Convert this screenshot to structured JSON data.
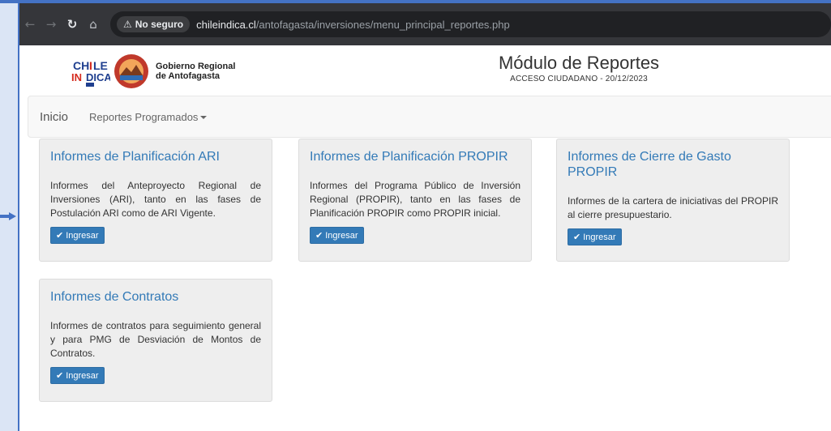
{
  "browser": {
    "back_icon": "back-arrow-icon",
    "forward_icon": "forward-arrow-icon",
    "reload_icon": "reload-icon",
    "home_icon": "home-icon",
    "security_label": "No seguro",
    "url_domain": "chileindica.cl",
    "url_path": "/antofagasta/inversiones/menu_principal_reportes.php"
  },
  "header": {
    "logo_text": "CHILE INDICA",
    "gov_line1": "Gobierno Regional",
    "gov_line2": "de Antofagasta",
    "title": "Módulo de Reportes",
    "subtitle": "ACCESO CIUDADANO  -  20/12/2023"
  },
  "nav": {
    "home": "Inicio",
    "dropdown": "Reportes Programados"
  },
  "cards": [
    {
      "title": "Informes de Planificación ARI",
      "description": "Informes del Anteproyecto Regional de Inversiones (ARI), tanto en las fases de Postulación ARI como de ARI Vigente.",
      "button": "Ingresar"
    },
    {
      "title": "Informes de Planificación PROPIR",
      "description": "Informes del Programa Público de Inversión Regional (PROPIR), tanto en las fases de Planificación PROPIR como PROPIR inicial.",
      "button": "Ingresar"
    },
    {
      "title": "Informes de Cierre de Gasto PROPIR",
      "description": "Informes de la cartera de iniciativas del PROPIR al cierre presupuestario.",
      "button": "Ingresar"
    },
    {
      "title": "Informes de Contratos",
      "description": "Informes de contratos para seguimiento general y para PMG de Desviación de Montos de Contratos.",
      "button": "Ingresar"
    }
  ],
  "colors": {
    "link_blue": "#337ab7",
    "frame_blue": "#4472c4",
    "card_bg": "#eeeeee"
  }
}
